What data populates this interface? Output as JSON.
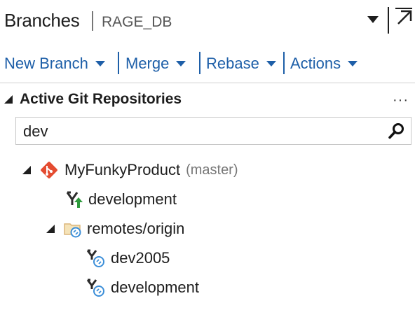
{
  "header": {
    "title": "Branches",
    "subtitle": "RAGE_DB"
  },
  "toolbar": {
    "new_branch": "New Branch",
    "merge": "Merge",
    "rebase": "Rebase",
    "actions": "Actions"
  },
  "section": {
    "title": "Active Git Repositories",
    "more": "···"
  },
  "search": {
    "value": "dev"
  },
  "tree": {
    "repo": {
      "name": "MyFunkyProduct",
      "current_branch": "(master)"
    },
    "local_branch": "development",
    "remote_group": "remotes/origin",
    "remote_branches": [
      "dev2005",
      "development"
    ]
  },
  "colors": {
    "link": "#1e5fa8",
    "git_red": "#e44c31",
    "remote_blue": "#3b8ed8",
    "folder": "#dcb67a",
    "arrow_green": "#2e9a3c"
  },
  "icons": [
    "dropdown-caret-icon",
    "popout-icon",
    "expand-triangle-icon",
    "more-icon",
    "search-icon",
    "git-repo-icon",
    "local-branch-icon",
    "remote-folder-icon",
    "remote-branch-icon"
  ]
}
